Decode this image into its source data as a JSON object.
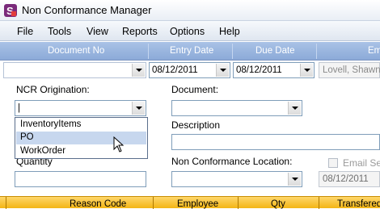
{
  "window": {
    "title": "Non Conformance Manager"
  },
  "menu": [
    "File",
    "Tools",
    "View",
    "Reports",
    "Options",
    "Help"
  ],
  "grid_header": {
    "columns": [
      "Document No",
      "Entry Date",
      "Due Date",
      "Em"
    ]
  },
  "row": {
    "entry_date": "08/12/2011",
    "due_date": "08/12/2011",
    "employee": "Lovell, Shawn"
  },
  "form": {
    "ncr_origination_label": "NCR Origination:",
    "ncr_origination_value": "|",
    "document_label": "Document:",
    "description_label": "Description",
    "quantity_label": "Quantity",
    "nc_location_label": "Non Conformance Location:",
    "email_label": "Email Se",
    "email_date": "08/12/2011"
  },
  "dropdown_options": [
    "InventoryItems",
    "PO",
    "WorkOrder"
  ],
  "bottom_header": {
    "columns": [
      "Reason Code",
      "Employee",
      "Qty",
      "Transfered"
    ]
  }
}
